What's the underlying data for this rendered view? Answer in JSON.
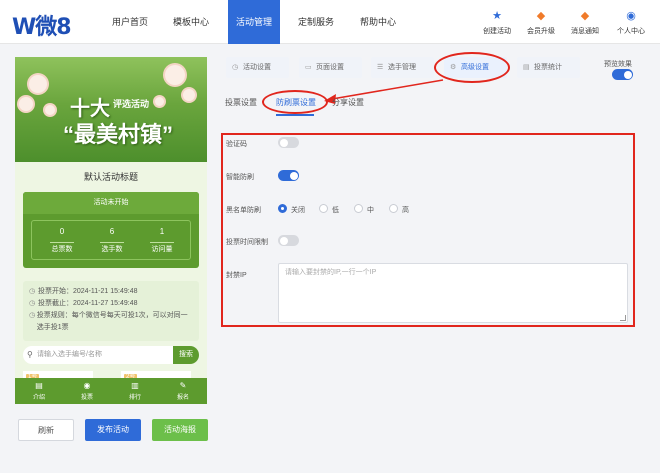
{
  "logo": {
    "text": "W",
    "text2": "微8"
  },
  "nav": [
    {
      "label": "用户首页"
    },
    {
      "label": "模板中心"
    },
    {
      "label": "活动管理"
    },
    {
      "label": "定制服务"
    },
    {
      "label": "帮助中心"
    }
  ],
  "top_actions": [
    {
      "label": "创建活动",
      "icon": "star-icon"
    },
    {
      "label": "会员升级",
      "icon": "vip-icon"
    },
    {
      "label": "消息通知",
      "icon": "bell-icon"
    },
    {
      "label": "个人中心",
      "icon": "user-icon"
    }
  ],
  "phone": {
    "banner_big1": "十大",
    "banner_small": "评选活动",
    "banner_big2": "“最美村镇”",
    "title": "默认活动标题",
    "status": "活动未开始",
    "stats": [
      {
        "value": "0",
        "label": "总票数"
      },
      {
        "value": "6",
        "label": "选手数"
      },
      {
        "value": "1",
        "label": "访问量"
      }
    ],
    "info": [
      {
        "text": "投票开始：2024-11-21 15:49:48"
      },
      {
        "text": "投票截止：2024-11-27 15:49:48"
      },
      {
        "text": "投票规则：每个微信号每天可投1次，可以对同一选手投1票"
      }
    ],
    "search_placeholder": "请输入选手编号/名称",
    "search_button": "搜索",
    "cards": [
      {
        "tag": "1号"
      },
      {
        "tag": "2号"
      }
    ],
    "bottom_nav": [
      {
        "label": "介绍",
        "icon": "doc-icon"
      },
      {
        "label": "投票",
        "icon": "vote-icon"
      },
      {
        "label": "排行",
        "icon": "rank-icon"
      },
      {
        "label": "报名",
        "icon": "signup-icon"
      }
    ]
  },
  "buttons": {
    "refresh": "刷新",
    "publish": "发布活动",
    "poster": "活动海报"
  },
  "main_tabs": [
    {
      "label": "活动设置"
    },
    {
      "label": "页面设置"
    },
    {
      "label": "选手管理"
    },
    {
      "label": "高级设置"
    },
    {
      "label": "投票统计"
    }
  ],
  "preview_label": "预览效果",
  "sub_tabs": [
    {
      "label": "投票设置"
    },
    {
      "label": "防刷票设置"
    },
    {
      "label": "分享设置"
    }
  ],
  "form": {
    "captcha_label": "验证码",
    "captcha_on": false,
    "smart_label": "智能防刷",
    "smart_on": true,
    "blacklist_label": "黑名单防刷",
    "blacklist_options": [
      "关闭",
      "低",
      "中",
      "高"
    ],
    "blacklist_selected": "关闭",
    "time_limit_label": "投票时间限制",
    "time_limit_on": false,
    "ip_label": "封禁IP",
    "ip_placeholder": "请输入要封禁的IP,一行一个IP"
  },
  "colors": {
    "accent": "#2f6bd8",
    "phone_green": "#5d9b2e",
    "annotation_red": "#e1261d"
  }
}
